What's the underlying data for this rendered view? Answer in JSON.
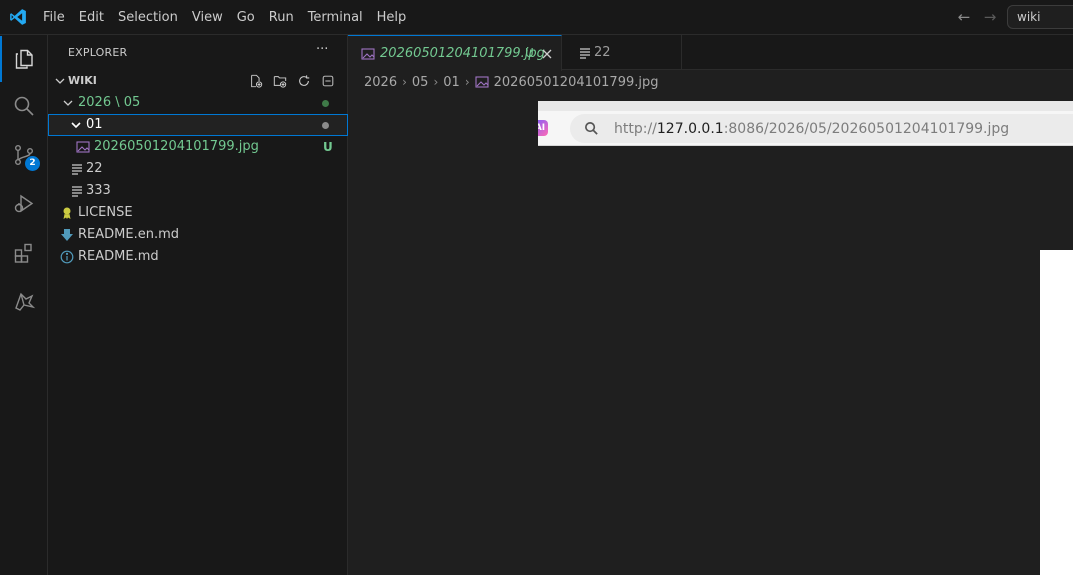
{
  "menu": [
    "File",
    "Edit",
    "Selection",
    "View",
    "Go",
    "Run",
    "Terminal",
    "Help"
  ],
  "command_center": "wiki",
  "activity": {
    "source_control_badge": "2"
  },
  "sidebar": {
    "title": "EXPLORER",
    "more": "···",
    "section": "WIKI",
    "tree": {
      "folder_2026_05": "2026 \\ 05",
      "folder_01": "01",
      "file_jpg": "20260501204101799.jpg",
      "file_jpg_status": "U",
      "file_22": "22",
      "file_333": "333",
      "file_license": "LICENSE",
      "file_readme_en": "README.en.md",
      "file_readme": "README.md"
    }
  },
  "editor": {
    "tabs": [
      {
        "label": "20260501204101799.jpg",
        "status": "U"
      },
      {
        "label": "22"
      }
    ],
    "breadcrumb": [
      "2026",
      "05",
      "01",
      "20260501204101799.jpg"
    ],
    "preview": {
      "ai_chip": "AI",
      "url_prefix": "http://",
      "url_host": "127.0.0.1",
      "url_rest": ":8086/2026/05/20260501204101799.jpg"
    }
  },
  "colors": {
    "accent": "#0078d4",
    "untracked": "#73c991",
    "image_icon": "#a074c4"
  }
}
